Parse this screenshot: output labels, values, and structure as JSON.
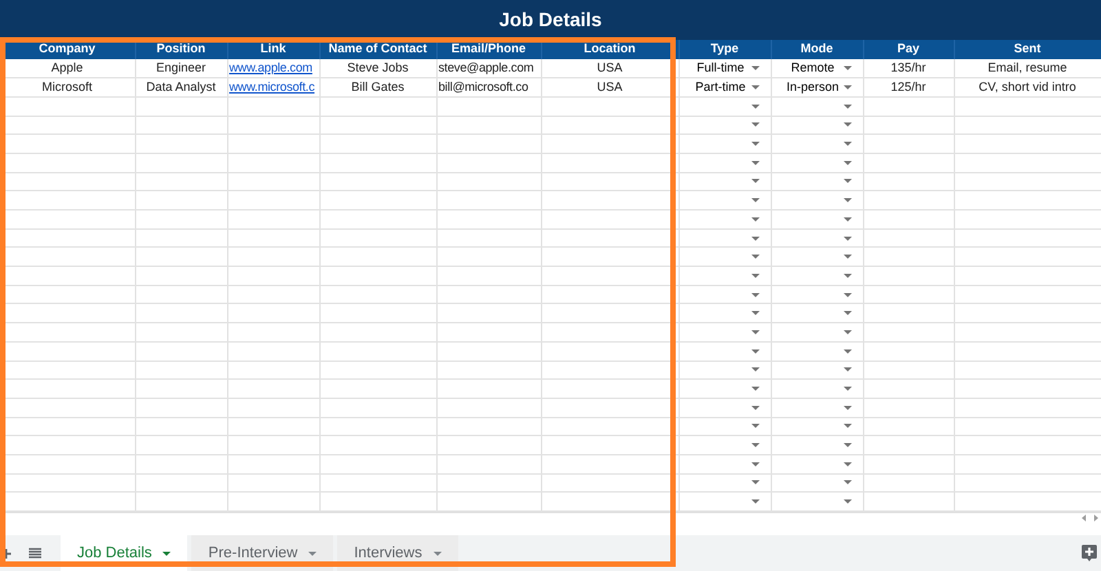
{
  "title": "Job Details",
  "table": {
    "columns": [
      {
        "label": "Company",
        "kind": "text"
      },
      {
        "label": "Position",
        "kind": "text"
      },
      {
        "label": "Link",
        "kind": "link"
      },
      {
        "label": "Name of Contact",
        "kind": "text"
      },
      {
        "label": "Email/Phone",
        "kind": "text"
      },
      {
        "label": "Location",
        "kind": "text"
      },
      {
        "label": "Type",
        "kind": "dropdown"
      },
      {
        "label": "Mode",
        "kind": "dropdown"
      },
      {
        "label": "Pay",
        "kind": "text"
      },
      {
        "label": "Sent",
        "kind": "text"
      }
    ],
    "rows": [
      [
        "Apple",
        "Engineer",
        "www.apple.com",
        "Steve Jobs",
        "steve@apple.com",
        "USA",
        "Full-time",
        "Remote",
        "135/hr",
        "Email, resume"
      ],
      [
        "Microsoft",
        "Data Analyst",
        "www.microsoft.c",
        "Bill Gates",
        "bill@microsoft.co",
        "USA",
        "Part-time",
        "In-person",
        "125/hr",
        "CV, short vid intro"
      ]
    ]
  },
  "sheet_tabs": [
    {
      "label": "Job Details",
      "selected": true
    },
    {
      "label": "Pre-Interview",
      "selected": false
    },
    {
      "label": "Interviews",
      "selected": false
    }
  ]
}
